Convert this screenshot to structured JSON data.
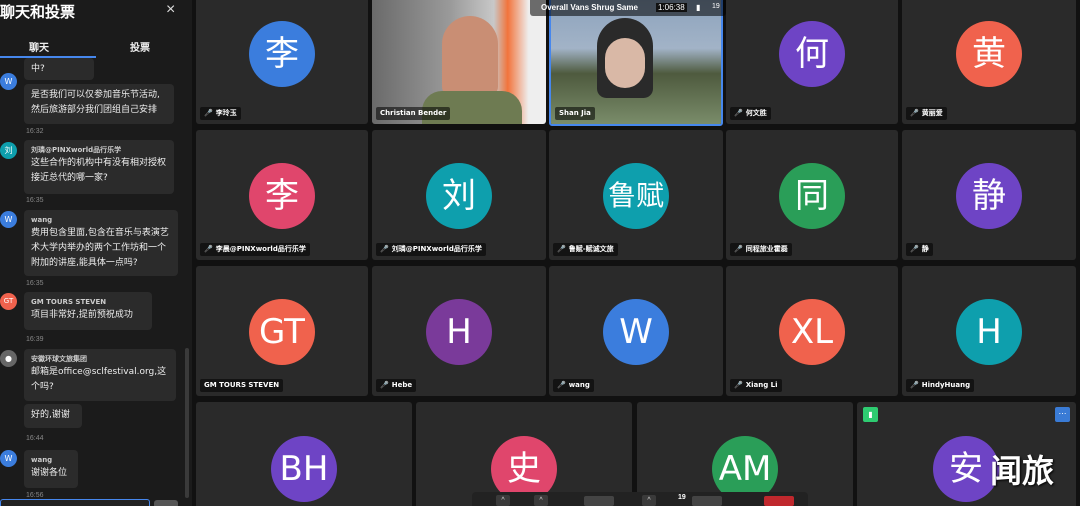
{
  "sidebar": {
    "title": "聊天和投票",
    "close": "×",
    "tabs": [
      {
        "label": "聊天"
      },
      {
        "label": "投票"
      }
    ]
  },
  "messages": {
    "m0": {
      "avatar": "W",
      "text": "中?"
    },
    "m1": {
      "text": "是否我们可以仅参加音乐节活动,然后旅游部分我们团组自己安排"
    },
    "t1": "16:32",
    "m2": {
      "avatar": "刘",
      "sender": "刘璘@PINXworld品行乐学",
      "text": "这些合作的机构中有没有相对授权接近总代的哪一家?"
    },
    "t2": "16:35",
    "m3": {
      "avatar": "W",
      "sender": "wang",
      "text": "费用包含里面,包含在音乐与表演艺术大学内举办的两个工作坊和一个附加的讲座,能具体一点吗?"
    },
    "t3": "16:35",
    "m4": {
      "avatar": "GT",
      "sender": "GM TOURS STEVEN",
      "text": "项目非常好,提前预祝成功"
    },
    "t4": "16:39",
    "m5": {
      "sender": "安徽环球文旅集团",
      "text": "邮箱是office@sclfestival.org,这个吗?"
    },
    "m6": {
      "text": "好的,谢谢"
    },
    "t6": "16:44",
    "m7": {
      "avatar": "W",
      "sender": "wang",
      "text": "谢谢各位"
    },
    "t7": "16:56"
  },
  "top_bar": {
    "logo": "jitsi",
    "title": "Overall Vans Shrug Same",
    "timer": "1:06:38",
    "participants": "19"
  },
  "tiles": [
    {
      "name": "李玲玉",
      "initials": "李",
      "color": "#3b7ddd"
    },
    {
      "name": "Christian Bender"
    },
    {
      "name": "Shan Jia"
    },
    {
      "name": "何文胜",
      "initials": "何",
      "color": "#6e44c5"
    },
    {
      "name": "黄丽爱",
      "initials": "黄",
      "color": "#f0624d"
    },
    {
      "name": "李晨@PINXworld品行乐学",
      "initials": "李",
      "color": "#e0466c"
    },
    {
      "name": "刘璘@PINXworld品行乐学",
      "initials": "刘",
      "color": "#0e9fad"
    },
    {
      "name": "鲁赋-赋诚文旅",
      "initials": "鲁赋",
      "color": "#0e9fad"
    },
    {
      "name": "同程旅业霍磊",
      "initials": "同",
      "color": "#2a9e58"
    },
    {
      "name": "静",
      "initials": "静",
      "color": "#6e44c5"
    },
    {
      "name": "GM TOURS STEVEN",
      "initials": "GT",
      "color": "#f0624d"
    },
    {
      "name": "Hebe",
      "initials": "H",
      "color": "#7a3a9a"
    },
    {
      "name": "wang",
      "initials": "W",
      "color": "#3b7ddd"
    },
    {
      "name": "Xiang Li",
      "initials": "XL",
      "color": "#f0624d"
    },
    {
      "name": "HindyHuang",
      "initials": "H",
      "color": "#0e9fad"
    },
    {
      "initials": "BH",
      "color": "#6e44c5"
    },
    {
      "initials": "史",
      "color": "#e0466c"
    },
    {
      "initials": "AM",
      "color": "#2a9e58"
    },
    {
      "initials": "安",
      "color": "#6e44c5"
    }
  ],
  "toolbar": {
    "participants": "19",
    "caret": "^"
  },
  "watermark": "闻旅",
  "icons": {
    "mic": "mic-muted-icon",
    "signal": "signal-icon",
    "more": "more-icon"
  }
}
